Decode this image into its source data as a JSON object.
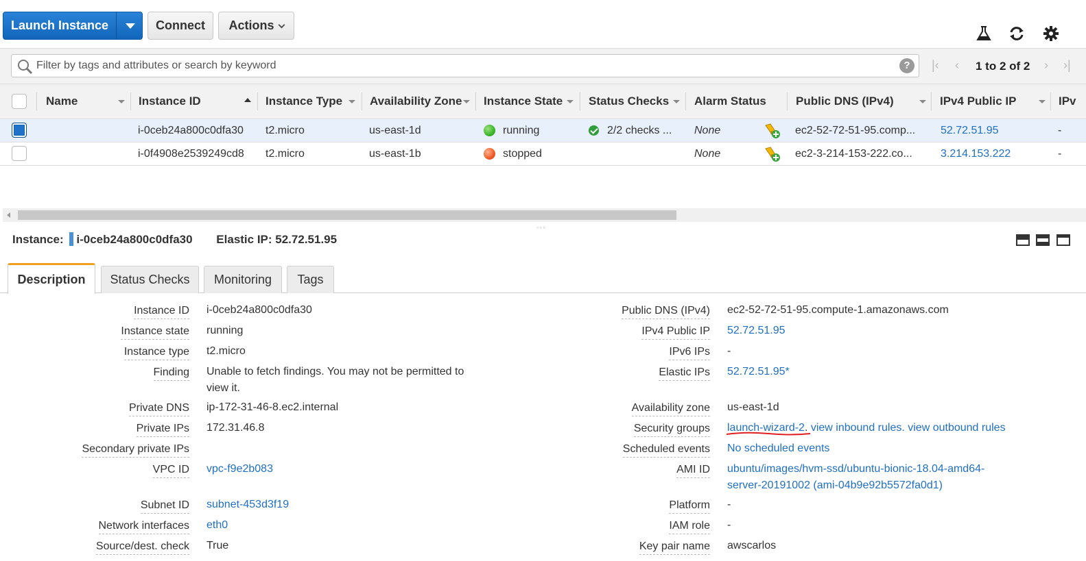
{
  "toolbar": {
    "launch_label": "Launch Instance",
    "connect_label": "Connect",
    "actions_label": "Actions",
    "icons": [
      "beaker-icon",
      "refresh-icon",
      "gear-icon"
    ]
  },
  "search": {
    "placeholder": "Filter by tags and attributes or search by keyword",
    "help": "?",
    "pagination": "1 to 2 of 2"
  },
  "table": {
    "columns": [
      "Name",
      "Instance ID",
      "Instance Type",
      "Availability Zone",
      "Instance State",
      "Status Checks",
      "Alarm Status",
      "Public DNS (IPv4)",
      "IPv4 Public IP",
      "IPv"
    ],
    "rows": [
      {
        "selected": true,
        "name": "",
        "instance_id": "i-0ceb24a800c0dfa30",
        "type": "t2.micro",
        "az": "us-east-1d",
        "state": "running",
        "state_color": "#3bb52a",
        "status_checks": "2/2 checks ...",
        "alarm": "None",
        "dns": "ec2-52-72-51-95.comp...",
        "ip": "52.72.51.95",
        "ipv6": "-"
      },
      {
        "selected": false,
        "name": "",
        "instance_id": "i-0f4908e2539249cd8",
        "type": "t2.micro",
        "az": "us-east-1b",
        "state": "stopped",
        "state_color": "#f05a28",
        "status_checks": "",
        "alarm": "None",
        "dns": "ec2-3-214-153-222.co...",
        "ip": "3.214.153.222",
        "ipv6": "-"
      }
    ]
  },
  "detail": {
    "instance_label": "Instance:",
    "instance_id": "i-0ceb24a800c0dfa30",
    "elastic_label": "Elastic IP: 52.72.51.95",
    "tabs": [
      "Description",
      "Status Checks",
      "Monitoring",
      "Tags"
    ],
    "left": [
      {
        "label": "Instance ID",
        "value": "i-0ceb24a800c0dfa30"
      },
      {
        "label": "Instance state",
        "value": "running"
      },
      {
        "label": "Instance type",
        "value": "t2.micro"
      },
      {
        "label": "Finding",
        "value": "Unable to fetch findings. You may not be permitted to view it."
      },
      {
        "label": "Private DNS",
        "value": "ip-172-31-46-8.ec2.internal"
      },
      {
        "label": "Private IPs",
        "value": "172.31.46.8"
      },
      {
        "label": "Secondary private IPs",
        "value": ""
      },
      {
        "label": "VPC ID",
        "value": "vpc-f9e2b083"
      },
      {
        "label": "Subnet ID",
        "value": "subnet-453d3f19"
      },
      {
        "label": "Network interfaces",
        "value": "eth0"
      },
      {
        "label": "Source/dest. check",
        "value": "True"
      }
    ],
    "right": [
      {
        "label": "Public DNS (IPv4)",
        "value": "ec2-52-72-51-95.compute-1.amazonaws.com"
      },
      {
        "label": "IPv4 Public IP",
        "value": "52.72.51.95"
      },
      {
        "label": "IPv6 IPs",
        "value": "-"
      },
      {
        "label": "Elastic IPs",
        "value": "52.72.51.95*"
      },
      {
        "label": "Availability zone",
        "value": "us-east-1d"
      },
      {
        "label": "Security groups",
        "value_link1": "launch-wizard-2",
        "value_link2": "view inbound rules",
        "value_link3": "view outbound rules"
      },
      {
        "label": "Scheduled events",
        "value": "No scheduled events"
      },
      {
        "label": "AMI ID",
        "value": "ubuntu/images/hvm-ssd/ubuntu-bionic-18.04-amd64-server-20191002 (ami-04b9e92b5572fa0d1)"
      },
      {
        "label": "Platform",
        "value": "-"
      },
      {
        "label": "IAM role",
        "value": "-"
      },
      {
        "label": "Key pair name",
        "value": "awscarlos"
      }
    ]
  },
  "colors": {
    "primary": "#1166bb",
    "link": "#1f6fc4",
    "tab_accent": "#f0a020",
    "annotation": "#e02020"
  }
}
